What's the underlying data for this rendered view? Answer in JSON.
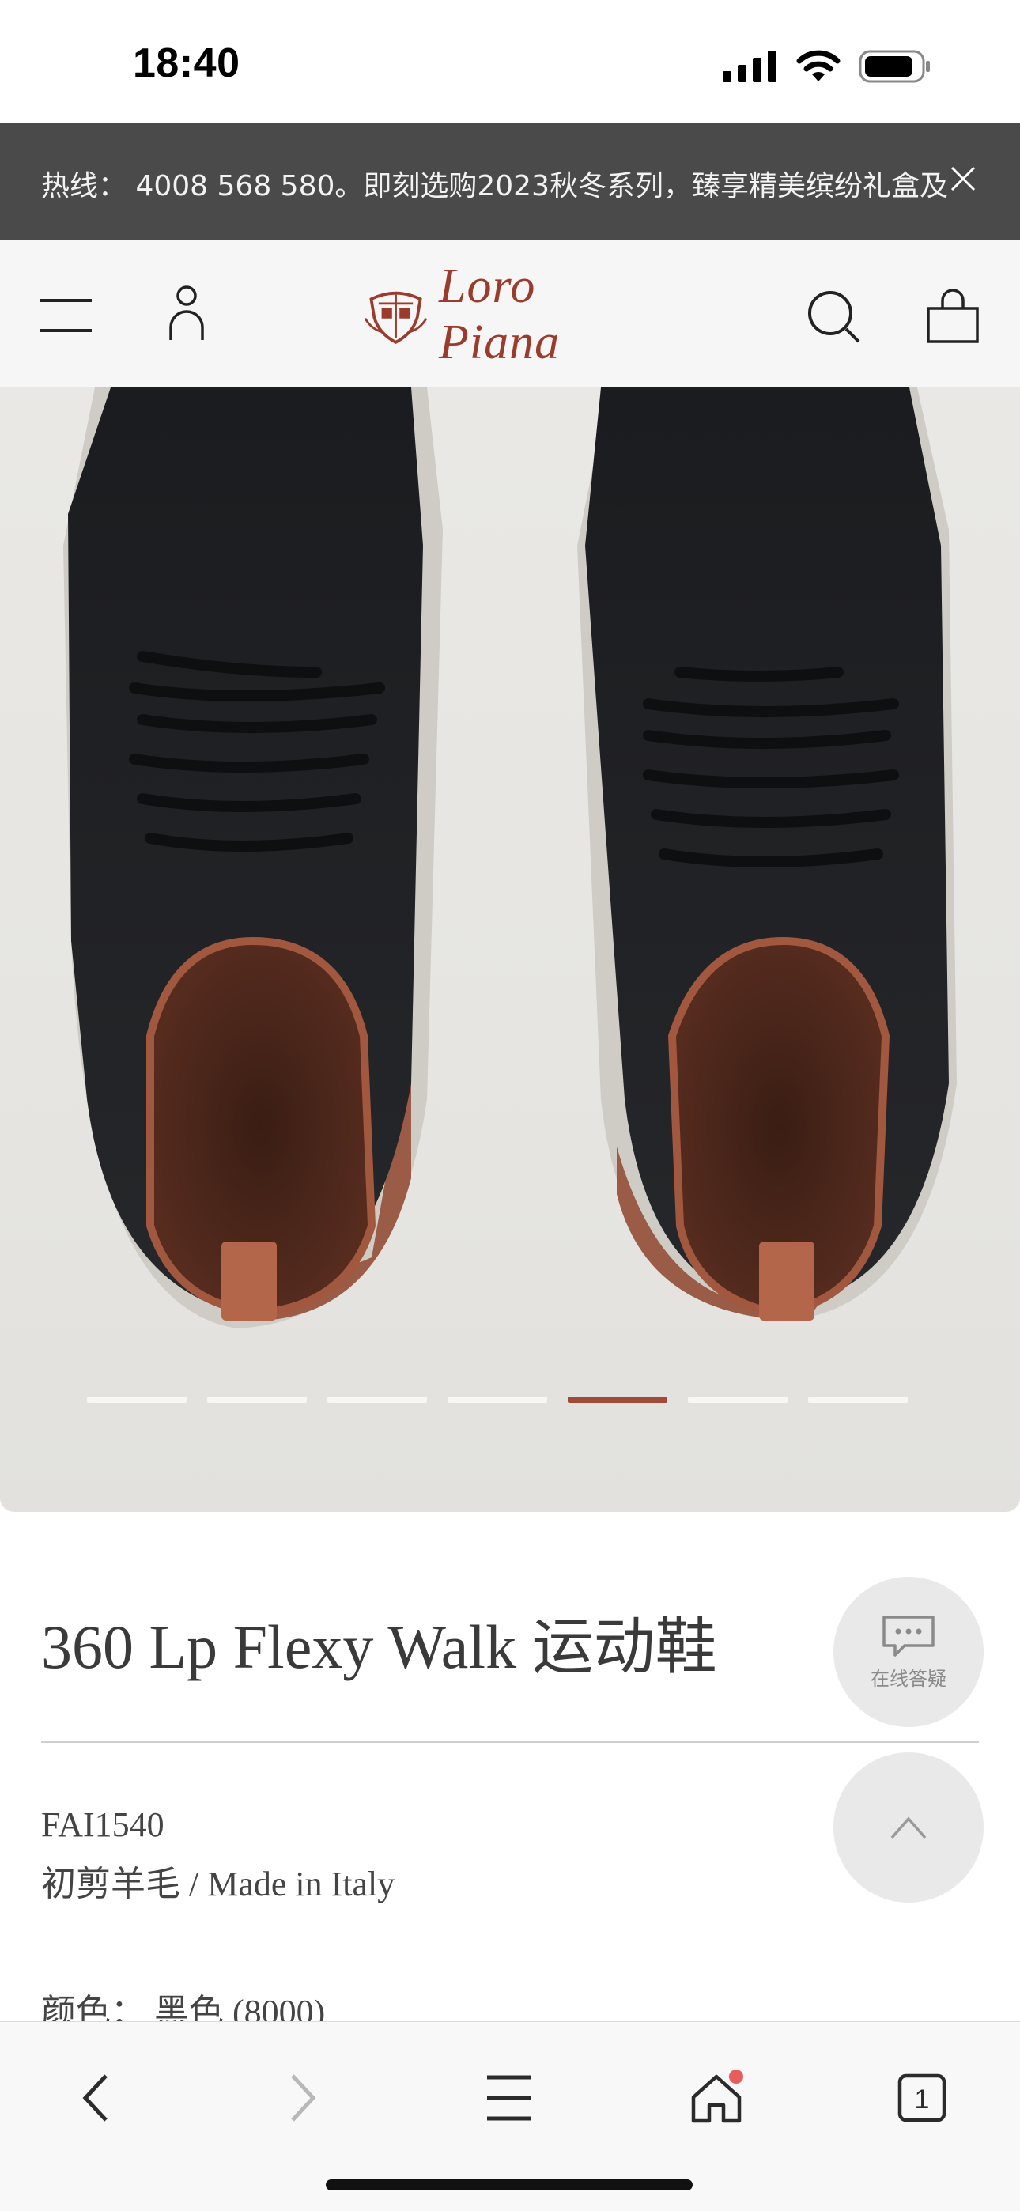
{
  "status_bar": {
    "time": "18:40"
  },
  "promo": {
    "text": "热线： 4008 568 580。即刻选购2023秋冬系列，臻享精美缤纷礼盒及"
  },
  "header": {
    "brand": "Loro Piana"
  },
  "carousel": {
    "total": 7,
    "active_index": 4
  },
  "product": {
    "title": "360 Lp Flexy Walk 运动鞋",
    "sku": "FAI1540",
    "material": "初剪羊毛 / Made in Italy",
    "color_line": "颜色：  黑色 (8000)"
  },
  "fabs": {
    "chat_label": "在线答疑"
  },
  "browser_toolbar": {
    "tabs_count": "1"
  },
  "colors": {
    "brand": "#9b3b2c",
    "promo_bg": "#4a4a4a",
    "dot_active": "#a04a38",
    "notification": "#e85c5c"
  },
  "icons": [
    "signal-icon",
    "wifi-icon",
    "battery-icon",
    "close-icon",
    "menu-icon",
    "account-icon",
    "search-icon",
    "shopping-bag-icon",
    "chat-icon",
    "arrow-up-icon",
    "back-icon",
    "forward-icon",
    "browser-menu-icon",
    "home-icon",
    "tabs-icon"
  ]
}
